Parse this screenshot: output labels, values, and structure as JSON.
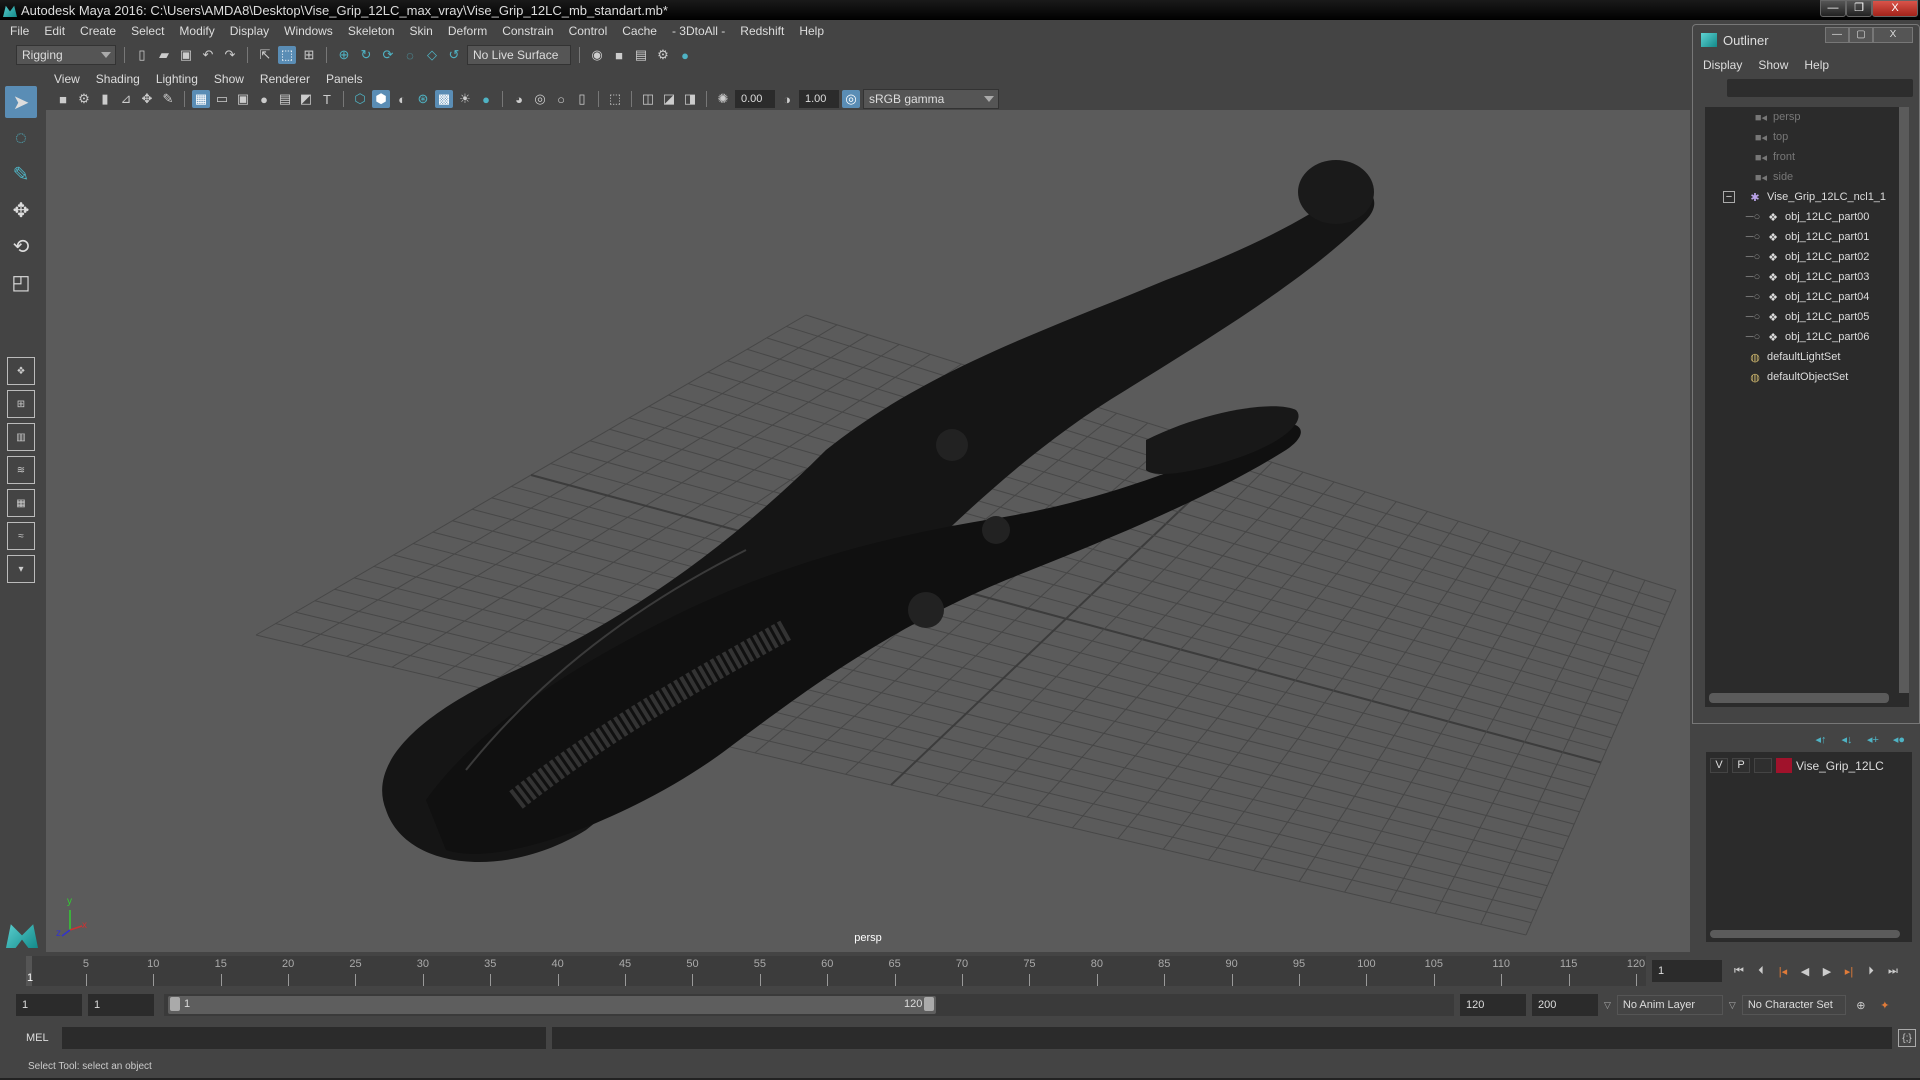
{
  "window": {
    "title": "Autodesk Maya 2016: C:\\Users\\AMDA8\\Desktop\\Vise_Grip_12LC_max_vray\\Vise_Grip_12LC_mb_standart.mb*",
    "minimize": "—",
    "maximize": "❐",
    "close": "X"
  },
  "menubar": [
    "File",
    "Edit",
    "Create",
    "Select",
    "Modify",
    "Display",
    "Windows",
    "Skeleton",
    "Skin",
    "Deform",
    "Constrain",
    "Control",
    "Cache",
    "- 3DtoAll -",
    "Redshift",
    "Help"
  ],
  "shelf": {
    "mode": "Rigging",
    "live_surface": "No Live Surface"
  },
  "panel": {
    "menu": [
      "View",
      "Shading",
      "Lighting",
      "Show",
      "Renderer",
      "Panels"
    ],
    "exposure": "0.00",
    "gamma": "1.00",
    "color_space": "sRGB gamma",
    "camera_label": "persp"
  },
  "axis": {
    "x": "x",
    "y": "y",
    "z": "z"
  },
  "outliner": {
    "title": "Outliner",
    "menu": [
      "Display",
      "Show",
      "Help"
    ],
    "items": [
      {
        "label": "persp",
        "type": "camera"
      },
      {
        "label": "top",
        "type": "camera"
      },
      {
        "label": "front",
        "type": "camera"
      },
      {
        "label": "side",
        "type": "camera"
      },
      {
        "label": "Vise_Grip_12LC_ncl1_1",
        "type": "group"
      },
      {
        "label": "obj_12LC_part00",
        "type": "mesh"
      },
      {
        "label": "obj_12LC_part01",
        "type": "mesh"
      },
      {
        "label": "obj_12LC_part02",
        "type": "mesh"
      },
      {
        "label": "obj_12LC_part03",
        "type": "mesh"
      },
      {
        "label": "obj_12LC_part04",
        "type": "mesh"
      },
      {
        "label": "obj_12LC_part05",
        "type": "mesh"
      },
      {
        "label": "obj_12LC_part06",
        "type": "mesh"
      },
      {
        "label": "defaultLightSet",
        "type": "set"
      },
      {
        "label": "defaultObjectSet",
        "type": "set"
      }
    ]
  },
  "layers": {
    "rows": [
      {
        "v": "V",
        "p": "P",
        "name": "Vise_Grip_12LC",
        "color": "#a0122b"
      }
    ]
  },
  "timeline": {
    "ticks": [
      "5",
      "10",
      "15",
      "20",
      "25",
      "30",
      "35",
      "40",
      "45",
      "50",
      "55",
      "60",
      "65",
      "70",
      "75",
      "80",
      "85",
      "90",
      "95",
      "100",
      "105",
      "110",
      "115",
      "120"
    ],
    "current_marker": "1",
    "current_frame": "1",
    "range_min": 1,
    "range_max": 120
  },
  "range": {
    "start": "1",
    "playback_start": "1",
    "slider_start": "1",
    "slider_end": "120",
    "end": "120",
    "anim_end": "200",
    "anim_layer": "No Anim Layer",
    "character_set": "No Character Set"
  },
  "command": {
    "label": "MEL"
  },
  "status": {
    "text": "Select Tool: select an object"
  }
}
